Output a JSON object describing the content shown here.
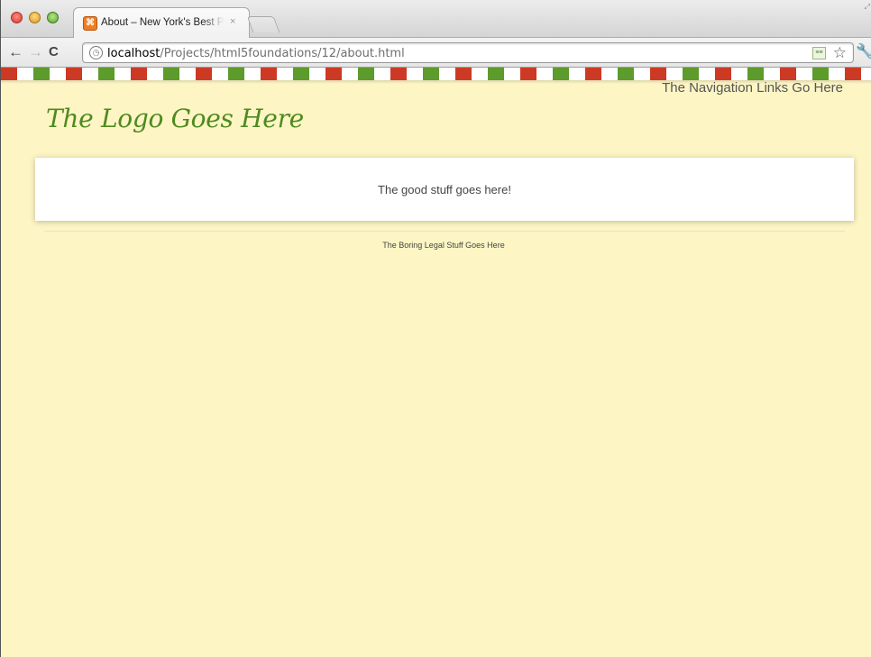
{
  "browser": {
    "tab_title": "About – New York's Best Pizza",
    "tab_close": "×",
    "url_host": "localhost",
    "url_path": "/Projects/html5foundations/12/about.html"
  },
  "icons": {
    "back": "back-arrow-icon",
    "forward": "forward-arrow-icon",
    "reload": "reload-icon",
    "globe": "globe-icon",
    "rss": "rss-icon",
    "star": "star-icon",
    "wrench": "wrench-icon"
  },
  "colors": {
    "page_bg": "#fdf5c4",
    "stripe": [
      "#cc3a26",
      "#ffffff",
      "#5c9b2c",
      "#ffffff"
    ],
    "logo": "#4e8a1f"
  },
  "page": {
    "nav_links": "The Navigation Links Go Here",
    "logo": "The Logo Goes Here",
    "content": "The good stuff goes here!",
    "legal": "The Boring Legal Stuff Goes Here"
  }
}
